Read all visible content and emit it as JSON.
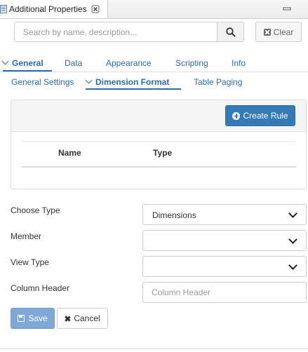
{
  "window": {
    "title": "Additional Properties"
  },
  "search": {
    "placeholder": "Search by name, description...",
    "clear_label": "Clear"
  },
  "main_tabs": [
    {
      "label": "General",
      "active": true
    },
    {
      "label": "Data"
    },
    {
      "label": "Appearance"
    },
    {
      "label": "Scripting"
    },
    {
      "label": "Info"
    }
  ],
  "sub_tabs": [
    {
      "label": "General Settings"
    },
    {
      "label": "Dimension Format",
      "active": true
    },
    {
      "label": "Table Paging"
    }
  ],
  "rules": {
    "create_label": "Create Rule",
    "columns": [
      "Name",
      "Type"
    ]
  },
  "form": {
    "choose_type": {
      "label": "Choose Type",
      "value": "Dimensions"
    },
    "member": {
      "label": "Member",
      "value": ""
    },
    "view_type": {
      "label": "View Type",
      "value": ""
    },
    "column_header": {
      "label": "Column Header",
      "placeholder": "Column Header"
    }
  },
  "actions": {
    "save_label": "Save",
    "cancel_label": "Cancel"
  },
  "colors": {
    "accent": "#2a6db3",
    "primary_button": "#337ab7",
    "save_button": "#7ea9d6"
  },
  "icons": [
    "properties-view-icon",
    "close-icon",
    "minimize-icon",
    "search-icon",
    "clear-icon",
    "plus-circle-icon",
    "chevron-down-icon",
    "floppy-icon",
    "x-icon"
  ]
}
